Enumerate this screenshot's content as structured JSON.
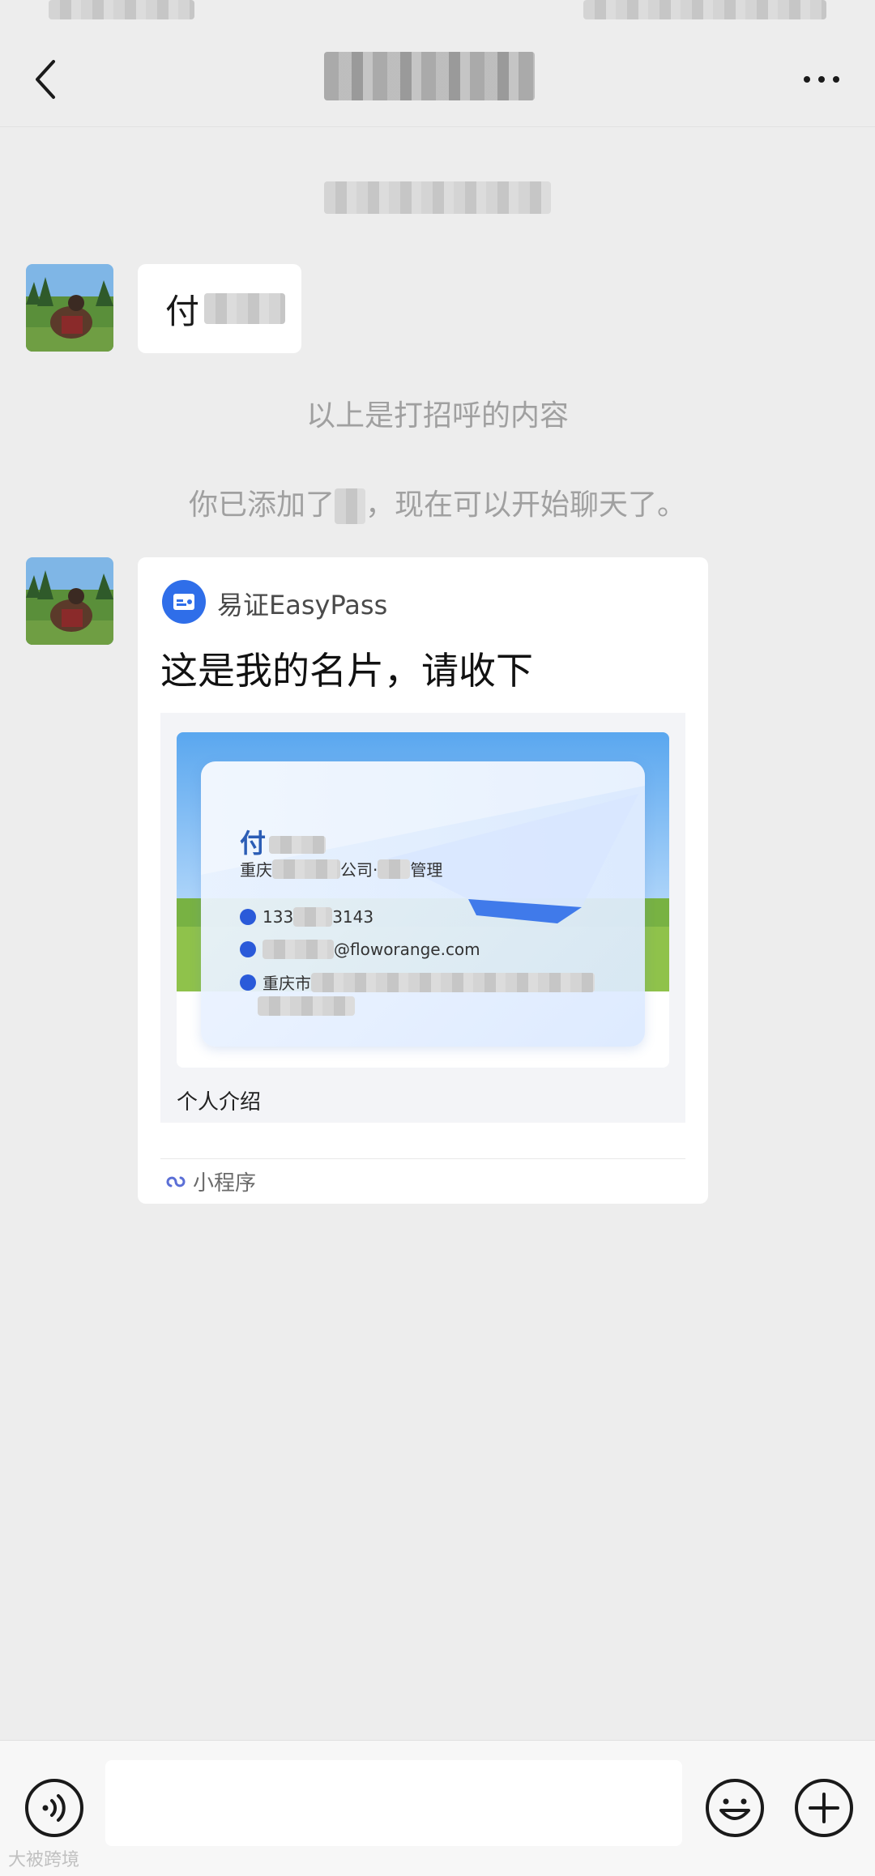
{
  "first_message": {
    "text": "付"
  },
  "system": {
    "greeting_note": "以上是打招呼的内容",
    "added_prefix": "你已添加了",
    "added_suffix": "，现在可以开始聊天了。"
  },
  "card": {
    "app_name": "易证EasyPass",
    "message": "这是我的名片，请收下",
    "intro_label": "个人介绍",
    "miniprogram_label": "小程序",
    "biz": {
      "name": "付",
      "company_prefix": "重庆",
      "company_mid": "公司·",
      "title_suffix": "管理",
      "phone_prefix": "133",
      "phone_suffix": "3143",
      "email_suffix": "@floworange.com",
      "address_prefix": "重庆市"
    }
  },
  "watermark": "大被跨境",
  "icons": {
    "back": "back-arrow-icon",
    "more": "more-icon",
    "voice": "voice-icon",
    "emoji": "emoji-icon",
    "plus": "plus-icon",
    "miniprogram": "miniprogram-icon"
  },
  "colors": {
    "background": "#ededed",
    "bubble": "#ffffff",
    "accent": "#2f6ee9"
  }
}
